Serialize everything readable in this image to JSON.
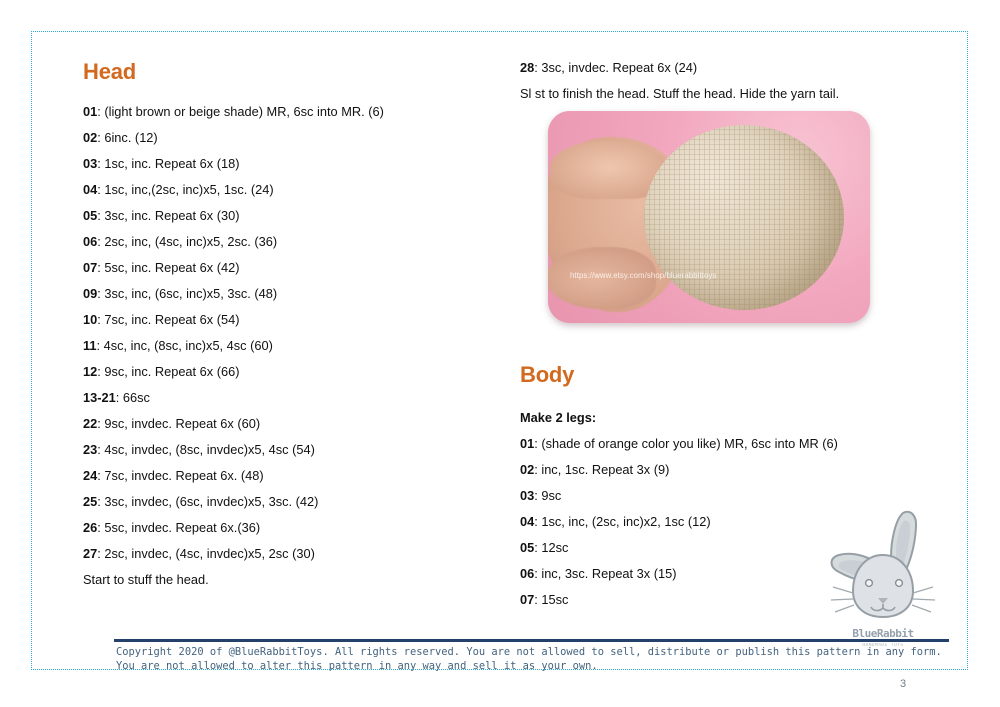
{
  "document": {
    "page_number": "3",
    "brand": "BlueRabbitToys"
  },
  "head_section": {
    "title": "Head",
    "rows": [
      "01: (light brown or beige shade) MR, 6sc into MR. (6)",
      "02: 6inc. (12)",
      "03: 1sc, inc. Repeat 6x (18)",
      "04: 1sc, inc,(2sc, inc)x5, 1sc. (24)",
      "05: 3sc, inc. Repeat 6x (30)",
      "06: 2sc, inc, (4sc, inc)x5, 2sc. (36)",
      "07: 5sc, inc. Repeat 6x (42)",
      "09: 3sc, inc, (6sc, inc)x5, 3sc. (48)",
      "10: 7sc, inc. Repeat 6x (54)",
      "11: 4sc, inc, (8sc, inc)x5, 4sc (60)",
      "12: 9sc, inc. Repeat 6x (66)",
      "13-21: 66sc",
      "22: 9sc, invdec. Repeat 6x (60)",
      "23:  4sc, invdec, (8sc, invdec)x5, 4sc (54)",
      "24: 7sc, invdec. Repeat 6x. (48)",
      "25: 3sc, invdec, (6sc, invdec)x5, 3sc. (42)",
      "26: 5sc, invdec. Repeat 6x.(36)",
      "27:  2sc, invdec, (4sc, invdec)x5, 2sc (30)"
    ],
    "note": "Start to stuff the head."
  },
  "head_continued": {
    "row_28": "28: 3sc, invdec. Repeat 6x (24)",
    "finish_note": "Sl st to finish the head. Stuff the head. Hide the yarn tail."
  },
  "photo": {
    "watermark": "https://www.etsy.com/shop/bluerabbittoys",
    "alt": "hand holding a beige crocheted ball head on pink background"
  },
  "body_section": {
    "title": "Body",
    "subtitle": "Make 2 legs:",
    "rows": [
      "01: (shade of orange color you like) MR, 6sc into MR (6)",
      "02: inc, 1sc. Repeat 3x (9)",
      "03: 9sc",
      "04: 1sc, inc, (2sc, inc)x2, 1sc (12)",
      "05: 12sc",
      "06:  inc, 3sc. Repeat 3x (15)",
      "07: 15sc"
    ]
  },
  "logo": {
    "text": "BlueRabbit",
    "sub": "HANDMADE TOYS"
  },
  "footer": {
    "copyright": "Copyright 2020 of @BlueRabbitToys. All rights reserved. You are not allowed to sell, distribute or publish this pattern in any form. You are  not allowed to alter this pattern in any way and sell it as your own."
  },
  "colors": {
    "heading": "#D2691E",
    "border": "#29ADD8",
    "footer_rule": "#24416B",
    "footer_text": "#44637F"
  }
}
